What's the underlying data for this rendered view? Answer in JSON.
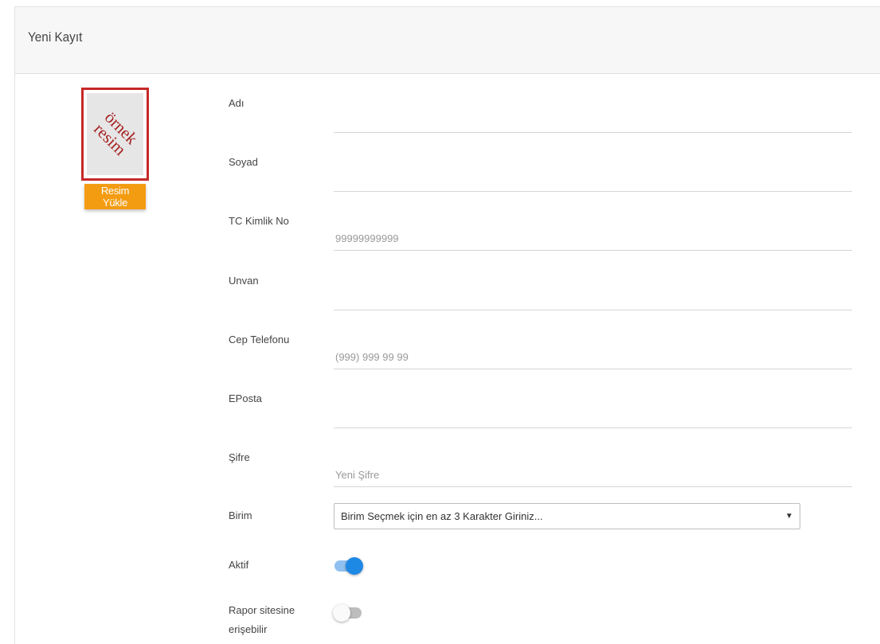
{
  "header": {
    "title": "Yeni Kayıt"
  },
  "avatar": {
    "placeholder_text": "örnek resim",
    "upload_label": "Resim Yükle"
  },
  "form": {
    "ad": {
      "label": "Adı",
      "value": "",
      "placeholder": ""
    },
    "soyad": {
      "label": "Soyad",
      "value": "",
      "placeholder": ""
    },
    "tc": {
      "label": "TC Kimlik No",
      "value": "",
      "placeholder": "99999999999"
    },
    "unvan": {
      "label": "Unvan",
      "value": "",
      "placeholder": ""
    },
    "cep": {
      "label": "Cep Telefonu",
      "value": "",
      "placeholder": "(999) 999 99 99"
    },
    "eposta": {
      "label": "EPosta",
      "value": "",
      "placeholder": ""
    },
    "sifre": {
      "label": "Şifre",
      "value": "",
      "placeholder": "Yeni Şifre"
    },
    "birim": {
      "label": "Birim",
      "selected": "Birim Seçmek için en az 3 Karakter Giriniz...",
      "arrow": "▼"
    },
    "aktif": {
      "label": "Aktif",
      "checked": true
    },
    "rapor": {
      "label_line1": "Rapor sitesine",
      "label_line2": "erişebilir",
      "checked": false
    }
  },
  "colors": {
    "accent_orange": "#f39c12",
    "avatar_border": "#c62828",
    "toggle_on": "#1e88e5",
    "toggle_off": "#bdbdbd"
  }
}
